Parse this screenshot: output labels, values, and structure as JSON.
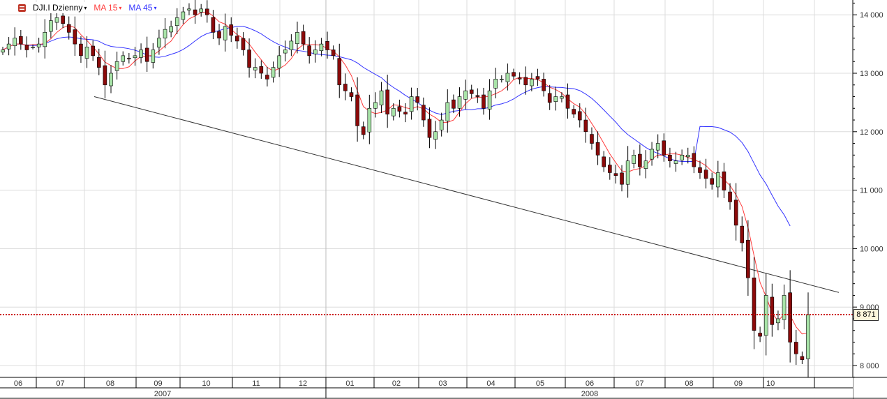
{
  "legend": {
    "symbol": "DJI.I Dzienny",
    "ma_fast": "MA 15",
    "ma_slow": "MA 45",
    "caret": "▾"
  },
  "current_price_label": "8 871",
  "colors": {
    "up": "#a8e4a8",
    "down": "#8b0a0a",
    "ma_fast": "#ff3b3b",
    "ma_slow": "#3434ff",
    "price_line": "#cc0000",
    "trendline": "#333333",
    "grid": "#dcdcdc"
  },
  "chart_data": {
    "type": "candlestick",
    "title": "DJI.I Dzienny",
    "ylim": [
      7800,
      14250
    ],
    "yticks": [
      8000,
      9000,
      10000,
      11000,
      12000,
      13000,
      14000
    ],
    "ytick_labels": [
      "8 000",
      "9 000",
      "10 000",
      "11 000",
      "12 000",
      "13 000",
      "14 000"
    ],
    "months": [
      "06",
      "07",
      "08",
      "09",
      "10",
      "11",
      "12",
      "01",
      "02",
      "03",
      "04",
      "05",
      "06",
      "07",
      "08",
      "09",
      "10"
    ],
    "years": [
      "2007",
      "2008"
    ],
    "grid": true,
    "indicators": [
      {
        "name": "MA 15",
        "window": 15
      },
      {
        "name": "MA 45",
        "window": 45
      }
    ],
    "current_price": 8871,
    "trendline": {
      "start": 12600,
      "end": 9250
    },
    "closes": [
      13400,
      13500,
      13600,
      13500,
      13400,
      13450,
      13500,
      13700,
      13900,
      13950,
      13850,
      13700,
      13500,
      13300,
      13450,
      13300,
      13100,
      12800,
      13000,
      13200,
      13300,
      13250,
      13300,
      13400,
      13200,
      13400,
      13600,
      13750,
      13800,
      13950,
      14050,
      14100,
      14000,
      14100,
      14000,
      13700,
      13600,
      13800,
      13650,
      13550,
      13400,
      13100,
      13100,
      13000,
      12900,
      13100,
      13300,
      13400,
      13550,
      13700,
      13500,
      13300,
      13400,
      13500,
      13400,
      13300,
      12800,
      12700,
      12600,
      12100,
      11950,
      12400,
      12500,
      12700,
      12300,
      12400,
      12350,
      12300,
      12600,
      12500,
      12200,
      11900,
      12000,
      12200,
      12500,
      12400,
      12600,
      12700,
      12650,
      12600,
      12400,
      12700,
      12900,
      12900,
      13000,
      12950,
      12900,
      12800,
      12900,
      12900,
      12700,
      12500,
      12600,
      12600,
      12400,
      12300,
      12200,
      12000,
      11800,
      11600,
      11400,
      11300,
      11250,
      11100,
      11500,
      11600,
      11400,
      11500,
      11700,
      11800,
      11600,
      11500,
      11500,
      11600,
      11600,
      11400,
      11300,
      11200,
      11100,
      11300,
      11000,
      10800,
      10400,
      10100,
      9500,
      8600,
      8500,
      9200,
      8700,
      8800,
      9200,
      8400,
      8200,
      8100,
      8871
    ]
  }
}
